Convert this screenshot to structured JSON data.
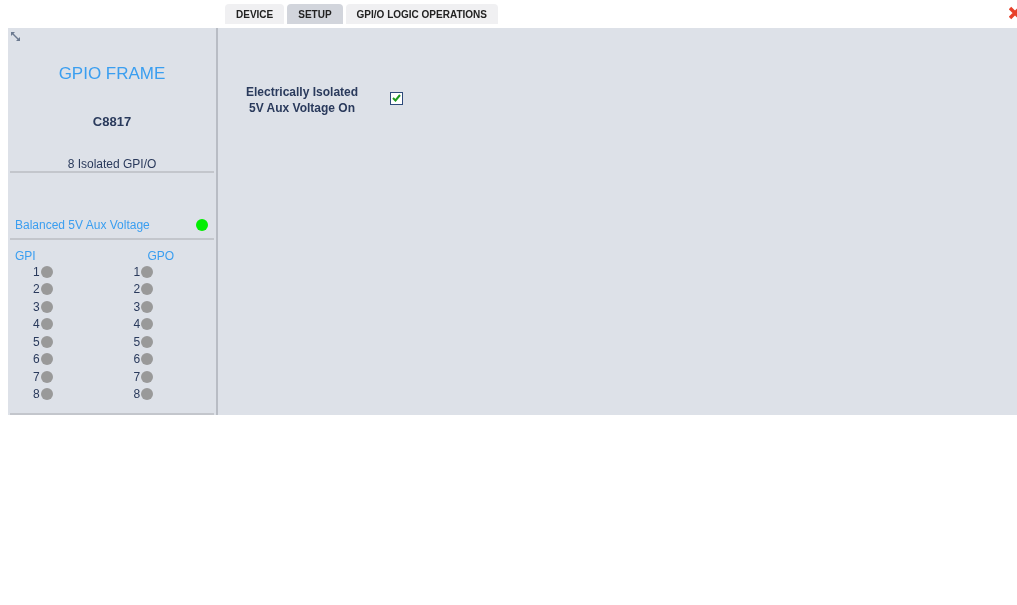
{
  "tabs": [
    {
      "label": "DEVICE",
      "selected": false
    },
    {
      "label": "SETUP",
      "selected": true
    },
    {
      "label": "GPI/O LOGIC OPERATIONS",
      "selected": false
    }
  ],
  "sidebar": {
    "title": "GPIO FRAME",
    "model": "C8817",
    "description": "8 Isolated GPI/O",
    "aux_voltage": {
      "label": "Balanced 5V Aux Voltage",
      "color": "#00ee00"
    },
    "gpi": {
      "heading": "GPI",
      "items": [
        {
          "number": "1",
          "color": "#999999"
        },
        {
          "number": "2",
          "color": "#999999"
        },
        {
          "number": "3",
          "color": "#999999"
        },
        {
          "number": "4",
          "color": "#999999"
        },
        {
          "number": "5",
          "color": "#999999"
        },
        {
          "number": "6",
          "color": "#999999"
        },
        {
          "number": "7",
          "color": "#999999"
        },
        {
          "number": "8",
          "color": "#999999"
        }
      ]
    },
    "gpo": {
      "heading": "GPO",
      "items": [
        {
          "number": "1",
          "color": "#999999"
        },
        {
          "number": "2",
          "color": "#999999"
        },
        {
          "number": "3",
          "color": "#999999"
        },
        {
          "number": "4",
          "color": "#999999"
        },
        {
          "number": "5",
          "color": "#999999"
        },
        {
          "number": "6",
          "color": "#999999"
        },
        {
          "number": "7",
          "color": "#999999"
        },
        {
          "number": "8",
          "color": "#999999"
        }
      ]
    }
  },
  "setup": {
    "fields": [
      {
        "kind": "checkbox",
        "label": "Electrically Isolated\n5V Aux Voltage On",
        "checked": true
      }
    ]
  }
}
